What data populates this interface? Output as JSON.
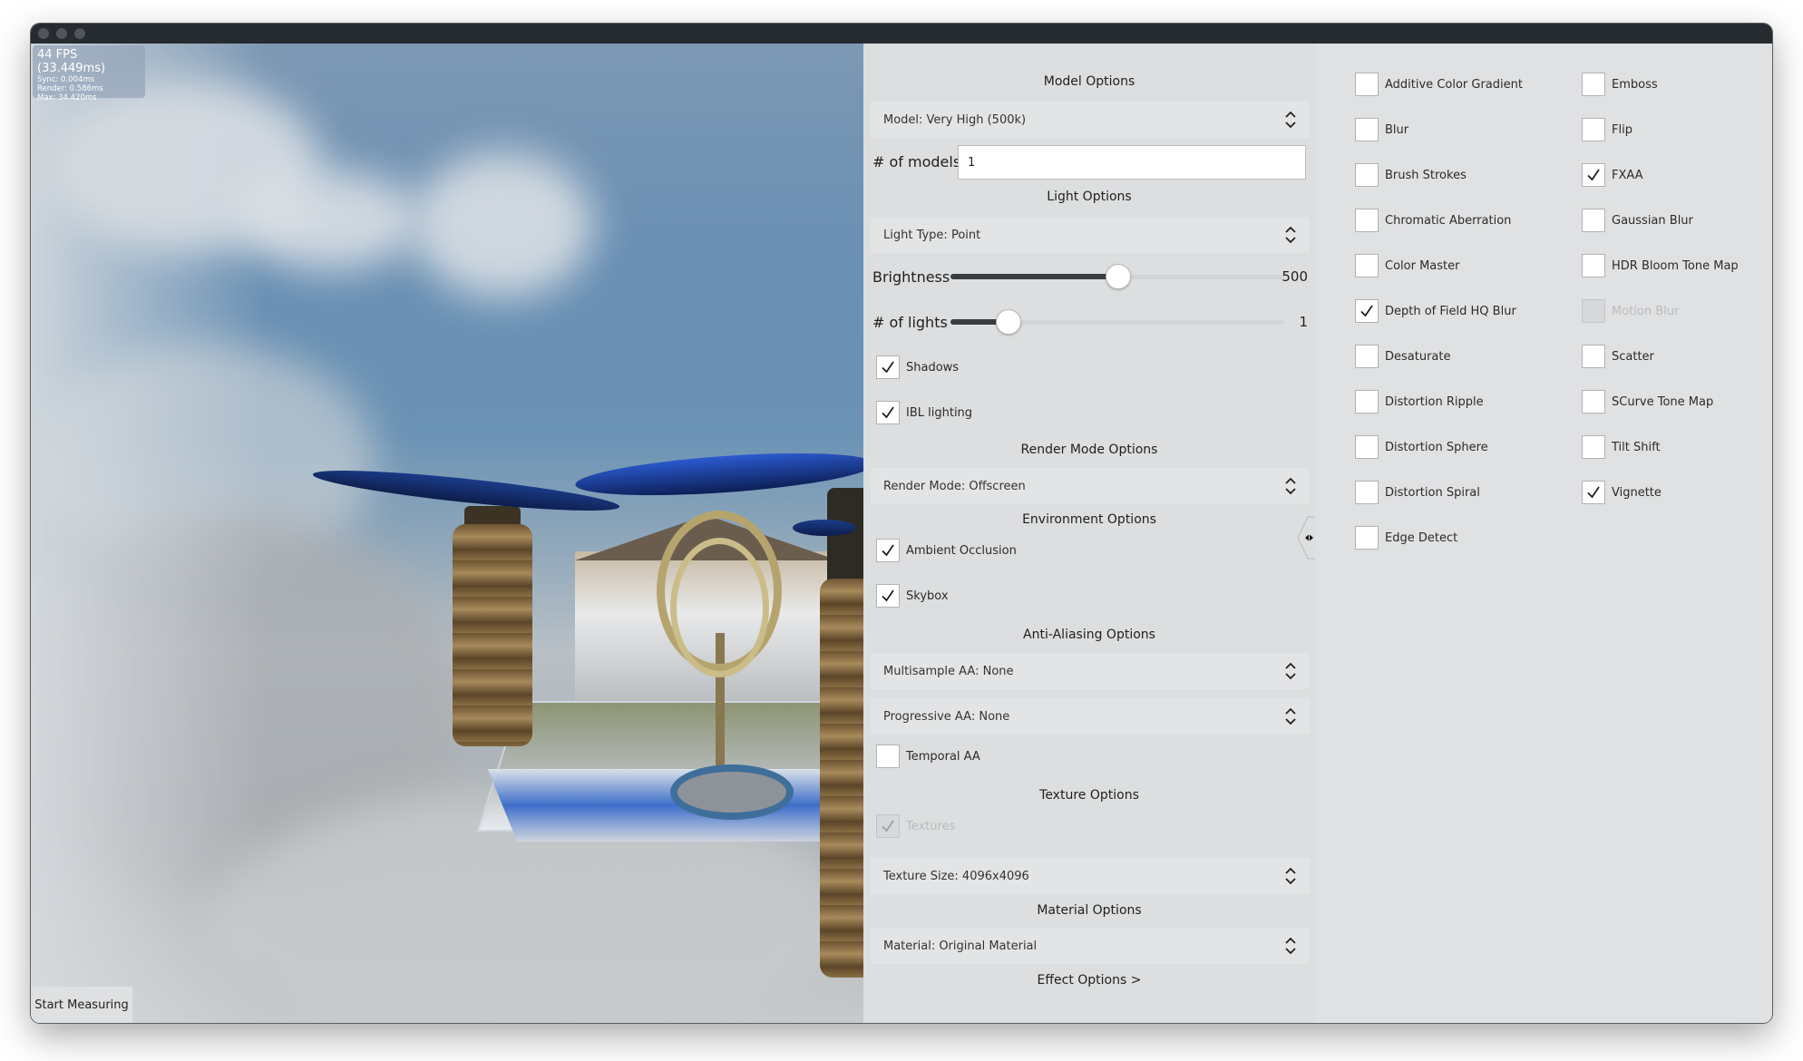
{
  "window": {
    "traffic_lights": [
      "close",
      "minimize",
      "zoom"
    ]
  },
  "stats": {
    "fps": "44 FPS (33.449ms)",
    "sync": "Sync: 0.004ms",
    "render": "Render: 0.586ms",
    "max": "Max: 34.420ms"
  },
  "viewport": {
    "start_measuring_label": "Start Measuring"
  },
  "panel": {
    "model": {
      "title": "Model Options",
      "model_select": "Model: Very High (500k)",
      "count_label": "# of models",
      "count_value": "1"
    },
    "light": {
      "title": "Light Options",
      "type_select": "Light Type: Point",
      "brightness_label": "Brightness",
      "brightness_value": "500",
      "brightness_fraction": 0.5,
      "lights_label": "# of lights",
      "lights_value": "1",
      "lights_fraction": 0.17,
      "checks": [
        {
          "label": "Shadows",
          "checked": true,
          "disabled": false
        },
        {
          "label": "IBL lighting",
          "checked": true,
          "disabled": false
        }
      ]
    },
    "render_mode": {
      "title": "Render Mode Options",
      "select": "Render Mode: Offscreen"
    },
    "environment": {
      "title": "Environment Options",
      "checks": [
        {
          "label": "Ambient Occlusion",
          "checked": true,
          "disabled": false
        },
        {
          "label": "Skybox",
          "checked": true,
          "disabled": false
        }
      ]
    },
    "anti_aliasing": {
      "title": "Anti-Aliasing Options",
      "multisample_select": "Multisample AA: None",
      "progressive_select": "Progressive AA: None",
      "checks": [
        {
          "label": "Temporal AA",
          "checked": false,
          "disabled": false
        }
      ]
    },
    "texture": {
      "title": "Texture Options",
      "checks": [
        {
          "label": "Textures",
          "checked": true,
          "disabled": true
        }
      ],
      "size_select": "Texture Size: 4096x4096"
    },
    "material": {
      "title": "Material Options",
      "select": "Material: Original Material"
    },
    "effect_options_link": "Effect Options >"
  },
  "effects": {
    "left_column": [
      {
        "label": "Additive Color Gradient",
        "checked": false,
        "disabled": false
      },
      {
        "label": "Blur",
        "checked": false,
        "disabled": false
      },
      {
        "label": "Brush Strokes",
        "checked": false,
        "disabled": false
      },
      {
        "label": "Chromatic Aberration",
        "checked": false,
        "disabled": false
      },
      {
        "label": "Color Master",
        "checked": false,
        "disabled": false
      },
      {
        "label": "Depth of Field HQ Blur",
        "checked": true,
        "disabled": false
      },
      {
        "label": "Desaturate",
        "checked": false,
        "disabled": false
      },
      {
        "label": "Distortion Ripple",
        "checked": false,
        "disabled": false
      },
      {
        "label": "Distortion Sphere",
        "checked": false,
        "disabled": false
      },
      {
        "label": "Distortion Spiral",
        "checked": false,
        "disabled": false
      },
      {
        "label": "Edge Detect",
        "checked": false,
        "disabled": false
      }
    ],
    "right_column": [
      {
        "label": "Emboss",
        "checked": false,
        "disabled": false
      },
      {
        "label": "Flip",
        "checked": false,
        "disabled": false
      },
      {
        "label": "FXAA",
        "checked": true,
        "disabled": false
      },
      {
        "label": "Gaussian Blur",
        "checked": false,
        "disabled": false
      },
      {
        "label": "HDR Bloom Tone Map",
        "checked": false,
        "disabled": false
      },
      {
        "label": "Motion Blur",
        "checked": false,
        "disabled": true
      },
      {
        "label": "Scatter",
        "checked": false,
        "disabled": false
      },
      {
        "label": "SCurve Tone Map",
        "checked": false,
        "disabled": false
      },
      {
        "label": "Tilt Shift",
        "checked": false,
        "disabled": false
      },
      {
        "label": "Vignette",
        "checked": true,
        "disabled": false
      }
    ]
  },
  "icons": {
    "select_arrows": "up-down-chevron-icon",
    "checkmark": "checkmark-icon",
    "collapse": "collapse-panel-icon"
  }
}
